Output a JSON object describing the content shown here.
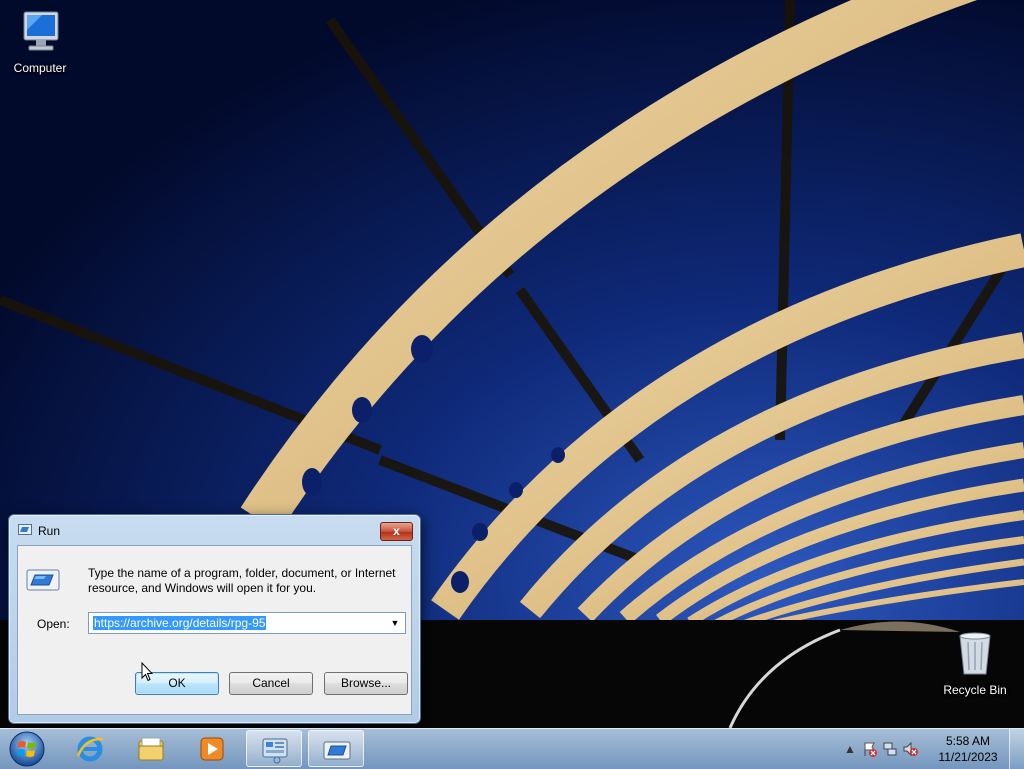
{
  "desktop": {
    "icons": [
      {
        "label": "Computer",
        "icon": "computer-icon"
      },
      {
        "label": "Recycle Bin",
        "icon": "recycle-bin-icon"
      }
    ]
  },
  "run_dialog": {
    "title": "Run",
    "close_label": "x",
    "description": "Type the name of a program, folder, document, or Internet resource, and Windows will open it for you.",
    "open_label": "Open:",
    "open_value": "https://archive.org/details/rpg-95",
    "buttons": {
      "ok": "OK",
      "cancel": "Cancel",
      "browse": "Browse..."
    }
  },
  "taskbar": {
    "pinned": [
      {
        "name": "internet-explorer",
        "icon": "ie-icon"
      },
      {
        "name": "windows-explorer",
        "icon": "folder-icon"
      },
      {
        "name": "media-player",
        "icon": "media-player-icon"
      },
      {
        "name": "control-panel",
        "icon": "control-panel-icon"
      },
      {
        "name": "run",
        "icon": "run-icon",
        "active": true
      }
    ],
    "clock": {
      "time": "5:58 AM",
      "date": "11/21/2023"
    }
  },
  "colors": {
    "selection": "#3399ff",
    "sky_top": "#02103a",
    "sky_bottom": "#1b3fa0",
    "structure": "#e8c98a"
  }
}
